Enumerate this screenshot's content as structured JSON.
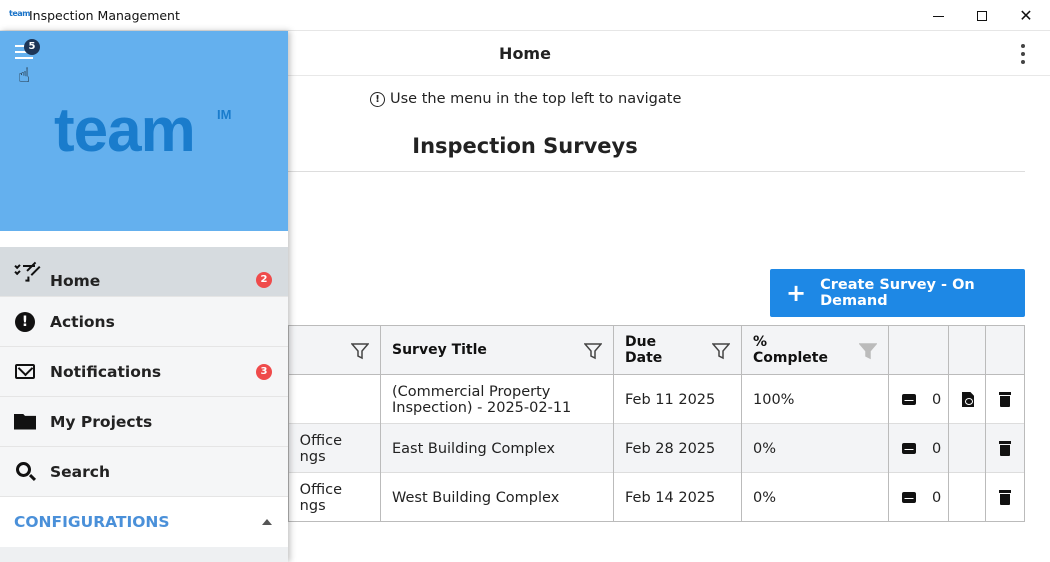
{
  "window": {
    "logo_text": "team",
    "title": "Inspection Management",
    "close_glyph": "✕"
  },
  "header": {
    "title": "Home",
    "menu_icon": "kebab-menu-icon"
  },
  "hint": {
    "icon": "ⓘ",
    "text": "Use the menu in the top left to navigate"
  },
  "section": {
    "title": "Inspection Surveys"
  },
  "create_button": {
    "icon": "+",
    "label": "Create Survey - On Demand"
  },
  "table": {
    "columns": [
      {
        "label": ""
      },
      {
        "label": "Survey Title"
      },
      {
        "label": "Due\nDate"
      },
      {
        "label": "%\nComplete"
      },
      {
        "label": ""
      },
      {
        "label": ""
      },
      {
        "label": ""
      }
    ],
    "rows": [
      {
        "project": "",
        "title": "(Commercial Property Inspection) - 2025-02-11",
        "due": "Feb 11 2025",
        "complete": "100%",
        "emails": "0",
        "has_pdf": true
      },
      {
        "project": "Office\nngs",
        "title": "East Building Complex",
        "due": "Feb 28 2025",
        "complete": "0%",
        "emails": "0",
        "has_pdf": false
      },
      {
        "project": "Office\nngs",
        "title": "West Building Complex",
        "due": "Feb 14 2025",
        "complete": "0%",
        "emails": "0",
        "has_pdf": false
      }
    ]
  },
  "drawer": {
    "menu_badge": "5",
    "brand": "team",
    "brand_mark": "IM",
    "items": [
      {
        "label": "Home",
        "icon": "checklist-icon",
        "badge": "2"
      },
      {
        "label": "Actions",
        "icon": "alert-icon",
        "badge": ""
      },
      {
        "label": "Notifications",
        "icon": "envelope-icon",
        "badge": "3"
      },
      {
        "label": "My Projects",
        "icon": "folder-open-icon",
        "badge": ""
      },
      {
        "label": "Search",
        "icon": "search-icon",
        "badge": ""
      }
    ],
    "configurations_label": "CONFIGURATIONS"
  },
  "colors": {
    "drawer_header": "#64b0ee",
    "brand": "#1a7ccc",
    "primary_button": "#1e88e5",
    "badge_red": "#ef4b4b",
    "config_label": "#4a90d9"
  }
}
